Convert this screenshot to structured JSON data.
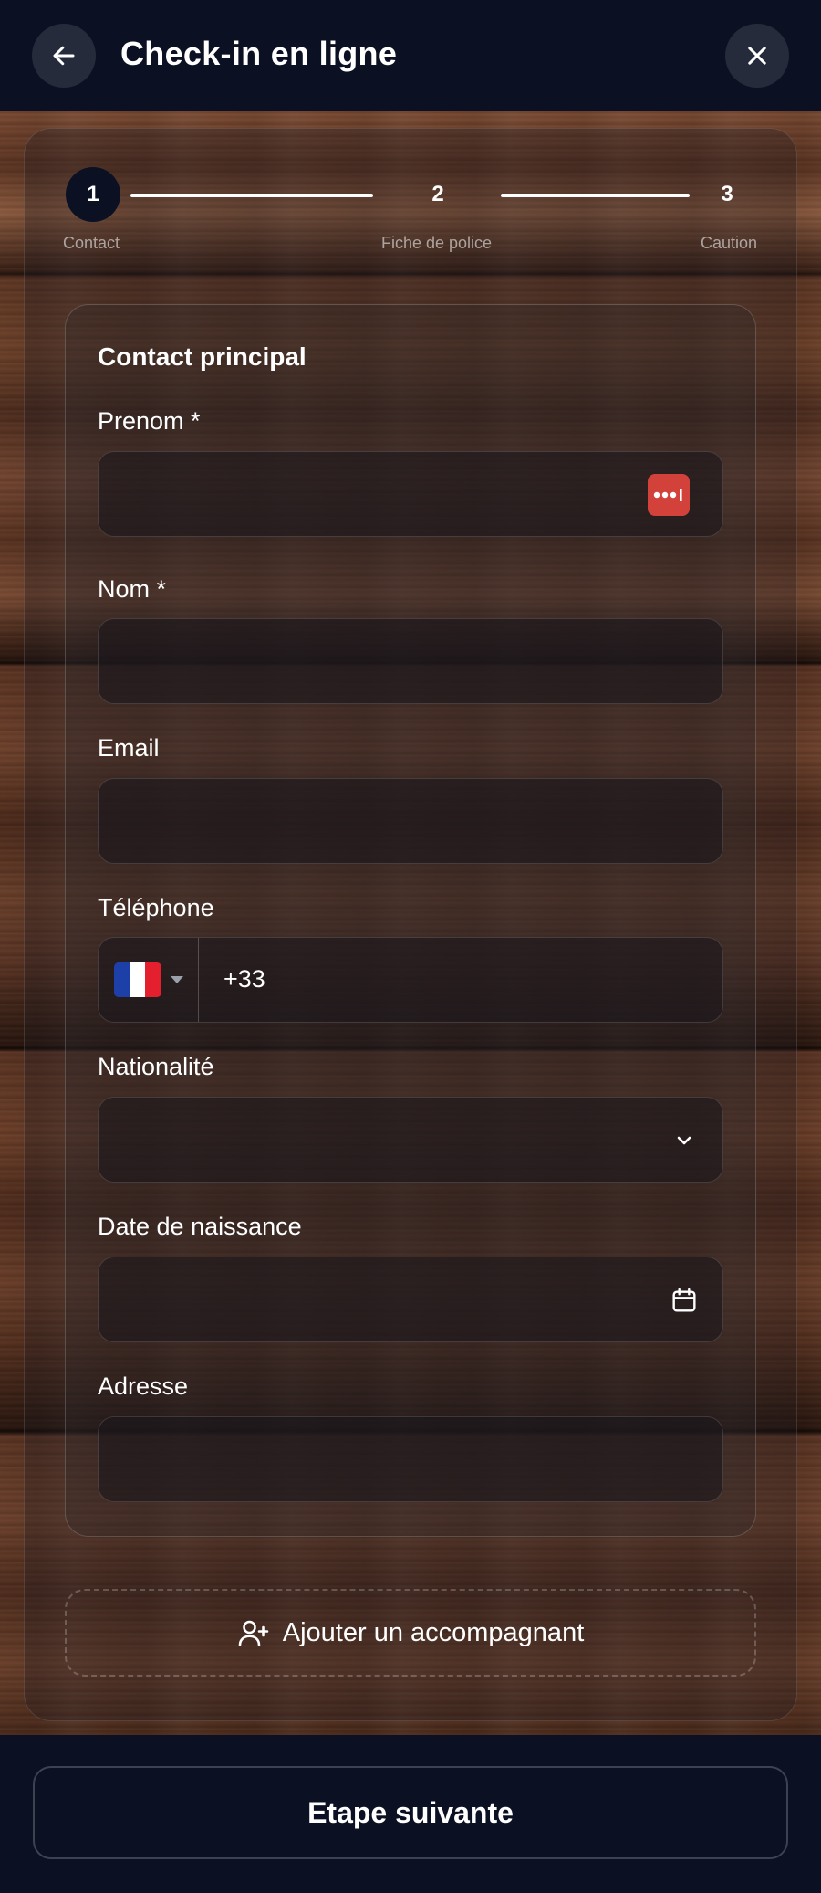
{
  "header": {
    "title": "Check-in en ligne",
    "back_icon": "arrow-left-icon",
    "close_icon": "close-icon"
  },
  "stepper": {
    "current_step": 1,
    "steps": [
      {
        "number": "1",
        "label": "Contact"
      },
      {
        "number": "2",
        "label": "Fiche de police"
      },
      {
        "number": "3",
        "label": "Caution"
      }
    ]
  },
  "form": {
    "section_title": "Contact principal",
    "fields": {
      "prenom": {
        "label": "Prenom *",
        "value": ""
      },
      "nom": {
        "label": "Nom *",
        "value": ""
      },
      "email": {
        "label": "Email",
        "value": ""
      },
      "telephone": {
        "label": "Téléphone",
        "country": "France",
        "prefix": "+33",
        "value": ""
      },
      "nationalite": {
        "label": "Nationalité",
        "value": ""
      },
      "date_naissance": {
        "label": "Date de naissance",
        "value": ""
      },
      "adresse": {
        "label": "Adresse",
        "value": ""
      }
    }
  },
  "add_companion": {
    "label": "Ajouter un accompagnant",
    "icon": "user-plus-icon"
  },
  "footer": {
    "next_label": "Etape suivante"
  },
  "colors": {
    "header_bg": "#0b1122",
    "password_manager_icon": "#d3413b",
    "flag_blue": "#1d3fa8",
    "flag_white": "#ffffff",
    "flag_red": "#e4202f"
  }
}
